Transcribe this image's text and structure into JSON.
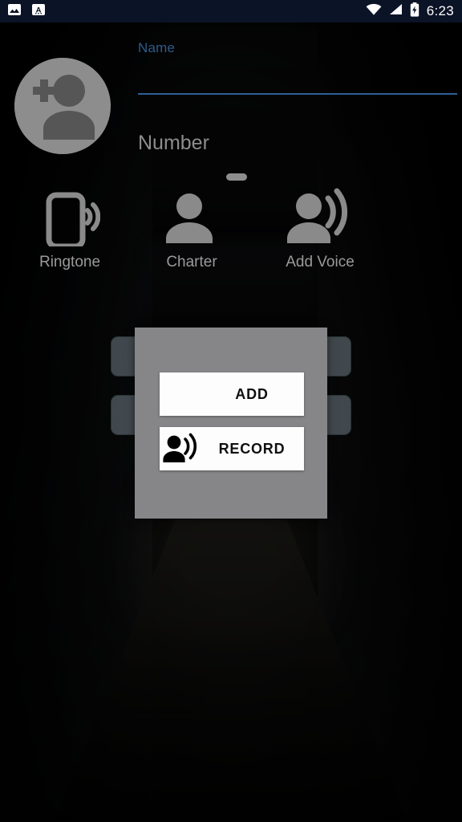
{
  "status_bar": {
    "left_icons": [
      {
        "name": "image-icon",
        "label": "screenshot"
      },
      {
        "name": "keyboard-language-icon",
        "label": "A"
      }
    ],
    "right_icons": [
      {
        "name": "wifi-icon",
        "label": "wifi"
      },
      {
        "name": "cellular-signal-icon",
        "label": "signal"
      },
      {
        "name": "battery-charging-icon",
        "label": "battery"
      }
    ],
    "time": "6:23",
    "background_color": "#0b1326"
  },
  "form": {
    "avatar": {
      "icon": "add-contact-avatar-icon",
      "color": "#8d8d8d"
    },
    "name": {
      "label": "Name",
      "value": "",
      "placeholder": "",
      "accent_color": "#2f5f91",
      "label_color": "#2f5c8c"
    },
    "number": {
      "label": "Number",
      "value": "",
      "placeholder": "Number",
      "placeholder_color": "#8d8d8d"
    }
  },
  "actions": [
    {
      "id": "ringtone",
      "icon": "phone-ringtone-icon",
      "label": "Ringtone"
    },
    {
      "id": "charter",
      "icon": "person-icon",
      "label": "Charter"
    },
    {
      "id": "voice",
      "icon": "person-voice-icon",
      "label": "Add Voice"
    }
  ],
  "background_buttons": [
    {
      "id": "background-button-1",
      "label": ""
    },
    {
      "id": "background-button-2",
      "label": ""
    }
  ],
  "dialog": {
    "background_color": "#868688",
    "buttons": [
      {
        "id": "add",
        "label": "ADD",
        "icon": null
      },
      {
        "id": "record",
        "label": "RECORD",
        "icon": "person-voice-icon"
      }
    ]
  }
}
